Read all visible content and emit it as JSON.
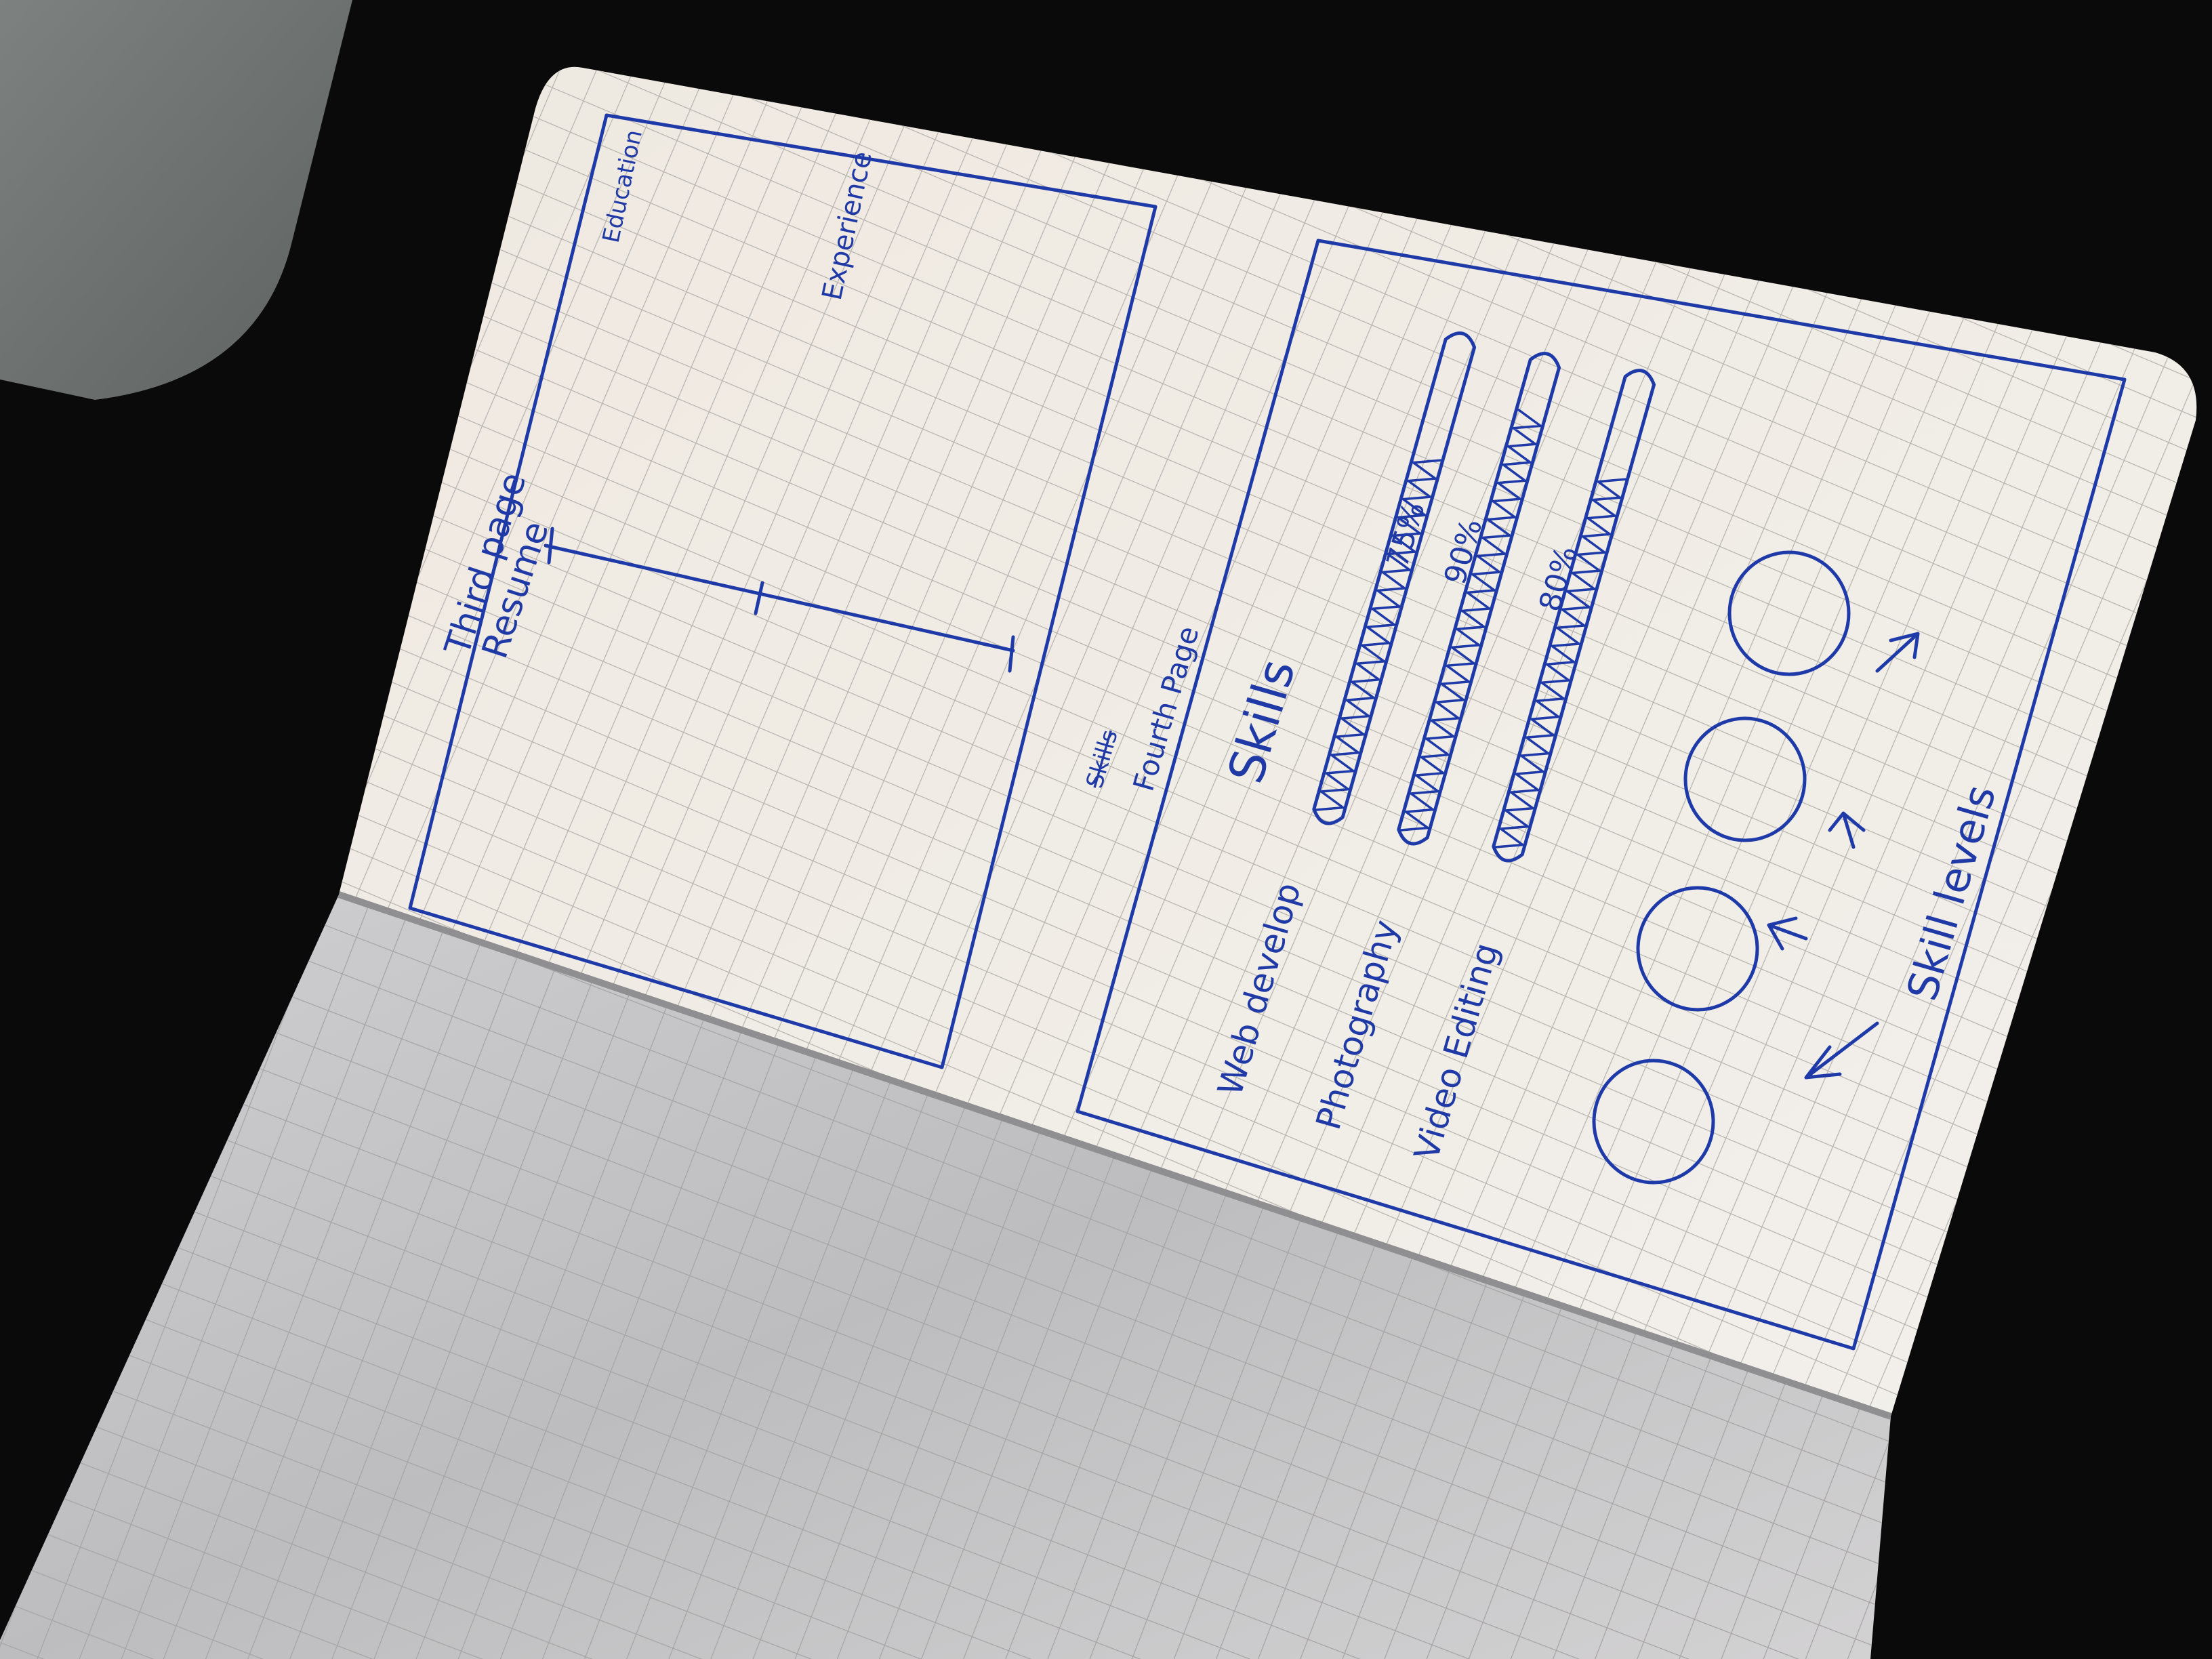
{
  "sketch": {
    "third_page": {
      "title_line1": "Third page",
      "title_line2": "Resume",
      "section_education": "Education",
      "section_experience": "Experience"
    },
    "fourth_page": {
      "scribble": "Skills",
      "title": "Fourth Page",
      "heading": "Skills",
      "skills": [
        {
          "label": "Web develop",
          "percent_label": "75%",
          "level": 0.75
        },
        {
          "label": "Photography",
          "percent_label": "90%",
          "level": 0.9
        },
        {
          "label": "Video Editing",
          "percent_label": "80%",
          "level": 0.8
        }
      ],
      "caption": "Skill levels"
    }
  },
  "colors": {
    "ink": "#1e3aa8",
    "paper": "#efece6",
    "grid": "#b9b6b3",
    "desk": "#0b0a0b"
  }
}
